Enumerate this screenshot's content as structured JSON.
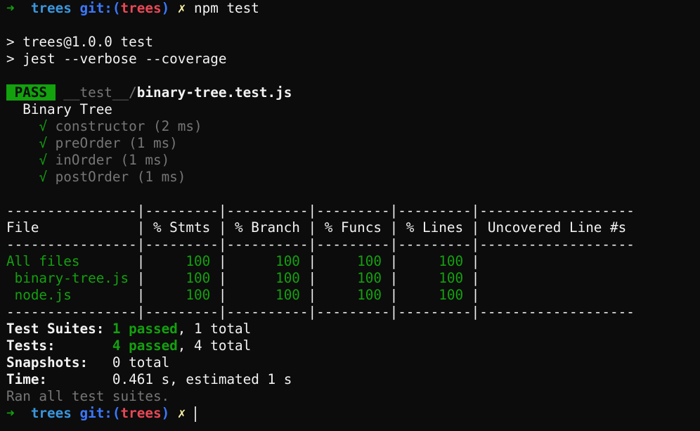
{
  "prompt": {
    "arrow": "➜",
    "dir": "trees",
    "git_label": "git:(",
    "branch": "trees",
    "git_close": ")",
    "dirty": "✗"
  },
  "command1": "npm test",
  "script_lines": [
    "> trees@1.0.0 test",
    "> jest --verbose --coverage"
  ],
  "test_file": {
    "status": "PASS",
    "dir": "__test__/",
    "file": "binary-tree.test.js",
    "suite": "Binary Tree",
    "check": "√",
    "cases": [
      "constructor (2 ms)",
      "preOrder (1 ms)",
      "inOrder (1 ms)",
      "postOrder (1 ms)"
    ]
  },
  "coverage": {
    "separator": "----------------|---------|----------|---------|---------|-------------------",
    "header": "File            | % Stmts | % Branch | % Funcs | % Lines | Uncovered Line #s ",
    "rows": [
      {
        "file": "All files       ",
        "stmts": "     100 ",
        "branch": "      100 ",
        "funcs": "     100 ",
        "lines": "     100 ",
        "uncovered": "                   "
      },
      {
        "file": " binary-tree.js ",
        "stmts": "     100 ",
        "branch": "      100 ",
        "funcs": "     100 ",
        "lines": "     100 ",
        "uncovered": "                   "
      },
      {
        "file": " node.js        ",
        "stmts": "     100 ",
        "branch": "      100 ",
        "funcs": "     100 ",
        "lines": "     100 ",
        "uncovered": "                   "
      }
    ]
  },
  "summary": {
    "suites_label": "Test Suites: ",
    "suites_passed": "1 passed",
    "suites_total": ", 1 total",
    "tests_label": "Tests:       ",
    "tests_passed": "4 passed",
    "tests_total": ", 4 total",
    "snapshots_label": "Snapshots:   ",
    "snapshots_value": "0 total",
    "time_label": "Time:        ",
    "time_value": "0.461 s, estimated 1 s",
    "ran": "Ran all test suites."
  },
  "colors": {
    "background": "#0c0c0c",
    "text": "#cccccc",
    "green": "#13a10e",
    "cyan": "#3a96dd",
    "blue": "#3b78ff",
    "red": "#e74856",
    "dim": "#767676"
  }
}
